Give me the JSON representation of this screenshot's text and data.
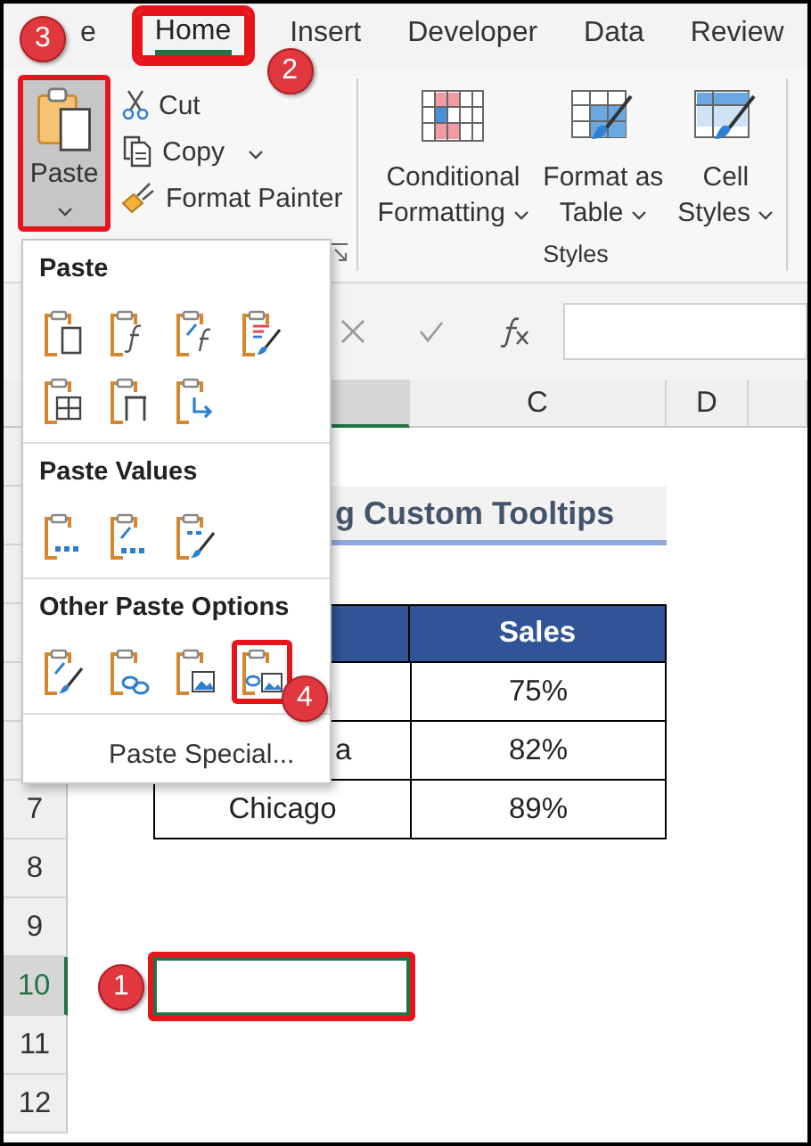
{
  "tabs": [
    {
      "label": "e",
      "selected": false,
      "highlighted": false
    },
    {
      "label": "Home",
      "selected": true,
      "highlighted": true,
      "badge": "2"
    },
    {
      "label": "Insert",
      "selected": false,
      "highlighted": false
    },
    {
      "label": "Developer",
      "selected": false,
      "highlighted": false
    },
    {
      "label": "Data",
      "selected": false,
      "highlighted": false
    },
    {
      "label": "Review",
      "selected": false,
      "highlighted": false
    }
  ],
  "ribbon": {
    "paste": {
      "label": "Paste",
      "pressed": true,
      "highlighted": true,
      "badge": "3"
    },
    "clipboard_items": [
      {
        "label": "Cut",
        "kind": "cut",
        "dropdown": false
      },
      {
        "label": "Copy",
        "kind": "copy",
        "dropdown": true
      },
      {
        "label": "Format Painter",
        "kind": "painter",
        "dropdown": false
      }
    ],
    "styles": {
      "label": "Styles",
      "buttons": [
        {
          "lines": [
            "Conditional",
            "Formatting"
          ],
          "kind": "conditional"
        },
        {
          "lines": [
            "Format as",
            "Table"
          ],
          "kind": "table"
        },
        {
          "lines": [
            "Cell",
            "Styles"
          ],
          "kind": "cell"
        }
      ]
    }
  },
  "paste_menu": {
    "sections": [
      {
        "title": "Paste",
        "options": [
          {
            "kind": "all",
            "highlighted": false
          },
          {
            "kind": "formulas",
            "highlighted": false
          },
          {
            "kind": "formulas-number",
            "highlighted": false
          },
          {
            "kind": "keep-source",
            "highlighted": false
          },
          {
            "kind": "no-borders",
            "highlighted": false
          },
          {
            "kind": "keep-widths",
            "highlighted": false
          },
          {
            "kind": "transpose",
            "highlighted": false
          }
        ]
      },
      {
        "title": "Paste Values",
        "options": [
          {
            "kind": "values",
            "highlighted": false
          },
          {
            "kind": "values-number",
            "highlighted": false
          },
          {
            "kind": "values-source",
            "highlighted": false
          }
        ]
      },
      {
        "title": "Other Paste Options",
        "options": [
          {
            "kind": "formatting",
            "highlighted": false
          },
          {
            "kind": "link",
            "highlighted": false
          },
          {
            "kind": "picture",
            "highlighted": false
          },
          {
            "kind": "linked-picture",
            "highlighted": true,
            "badge": "4"
          }
        ]
      }
    ],
    "footer": "Paste Special..."
  },
  "sheet": {
    "columns": [
      {
        "label": "C"
      },
      {
        "label": "D"
      }
    ],
    "rows": [
      {
        "number": "7",
        "selected": false
      },
      {
        "number": "8",
        "selected": false
      },
      {
        "number": "9",
        "selected": false
      },
      {
        "number": "10",
        "selected": true
      },
      {
        "number": "11",
        "selected": false
      },
      {
        "number": "12",
        "selected": false
      }
    ],
    "title": "g Custom Tooltips",
    "table": {
      "header": "Sales",
      "rows": [
        {
          "sales": "75%"
        },
        {
          "city": "a",
          "cut": true,
          "sales": "82%"
        },
        {
          "city": "Chicago",
          "cut": false,
          "sales": "89%"
        }
      ]
    },
    "active_cell": {
      "highlighted": true,
      "badge": "1"
    }
  }
}
